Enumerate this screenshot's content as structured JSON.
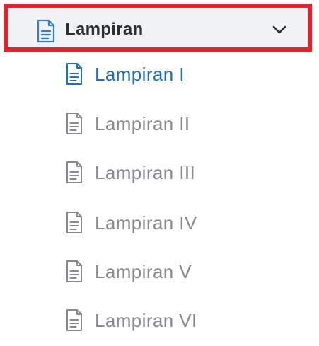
{
  "header": {
    "label": "Lampiran",
    "icon": "document-icon",
    "expand_icon": "chevron-down-icon",
    "expanded": true,
    "icon_color": "#2f7fd3",
    "text_color": "#2c2f36",
    "background_color": "#f1f2f6",
    "highlight_border_color": "#e8202a"
  },
  "items": [
    {
      "label": "Lampiran I",
      "icon": "document-icon",
      "active": true
    },
    {
      "label": "Lampiran II",
      "icon": "document-icon",
      "active": false
    },
    {
      "label": "Lampiran III",
      "icon": "document-icon",
      "active": false
    },
    {
      "label": "Lampiran IV",
      "icon": "document-icon",
      "active": false
    },
    {
      "label": "Lampiran V",
      "icon": "document-icon",
      "active": false
    },
    {
      "label": "Lampiran VI",
      "icon": "document-icon",
      "active": false
    }
  ],
  "colors": {
    "active_item": "#1d6fc4",
    "inactive_item": "#878a8f"
  }
}
